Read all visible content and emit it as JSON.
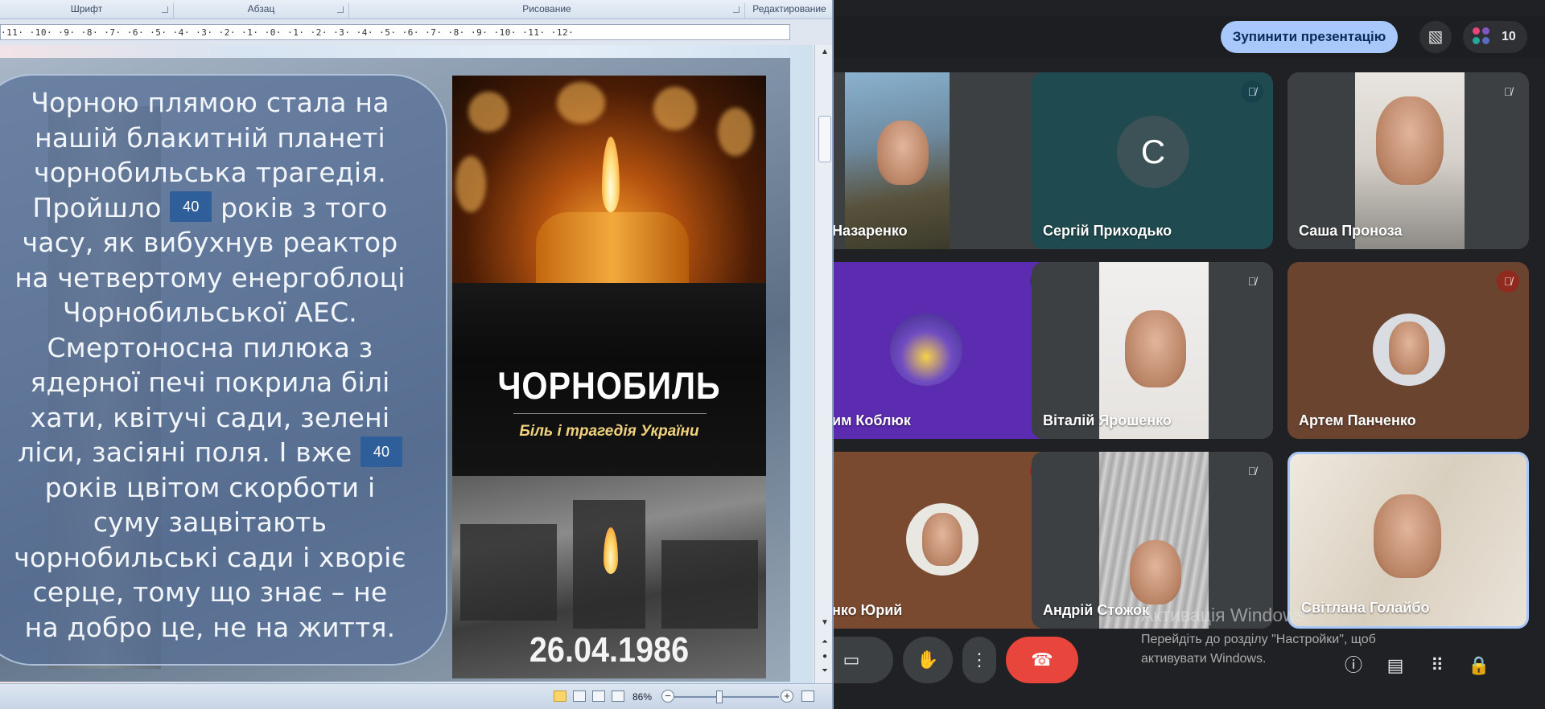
{
  "word": {
    "ribbon_groups": [
      "Шрифт",
      "Абзац",
      "Рисование",
      "Редактирование"
    ],
    "ruler": "·11·  ·10·  ·9·  ·8·  ·7·  ·6·  ·5·  ·4·  ·3·  ·2·  ·1·  ·0·  ·1·  ·2·  ·3·  ·4·  ·5·  ·6·  ·7·  ·8·  ·9·  ·10·  ·11·  ·12·",
    "slide": {
      "lines": [
        "Чорною плямою стала на",
        "нашій блакитній планеті",
        "чорнобильська трагедія.",
        "Пройшло",
        "років з того",
        "часу, як вибухнув реактор",
        "на четвертому енергоблоці",
        "Чорнобильської АЕС.",
        "Смертоносна пилюка з",
        "ядерної печі покрила білі",
        "хати, квітучі сади, зелені",
        "ліси, засіяні поля. І вже",
        "років цвітом скорботи і",
        "суму зацвітають",
        "чорнобильські сади і хворіє",
        "серце, тому що знає – не",
        "на добро це, не на життя."
      ],
      "badge1": "40",
      "badge2": "40"
    },
    "poster": {
      "title": "ЧОРНОБИЛЬ",
      "subtitle": "Біль і трагедія України",
      "date": "26.04.1986"
    },
    "zoom": "86%"
  },
  "meet": {
    "stop_presentation": "Зупинити презентацію",
    "participants_count": "10",
    "tiles": [
      {
        "name": "Назаренко"
      },
      {
        "name": "Сергій Приходько",
        "initial": "С"
      },
      {
        "name": "Саша Проноза"
      },
      {
        "name": "им Коблюк"
      },
      {
        "name": "Віталій Ярошенко"
      },
      {
        "name": "Артем Панченко"
      },
      {
        "name": "нко Юрий"
      },
      {
        "name": "Андрій Стожок"
      },
      {
        "name": "Світлана Голайбо"
      }
    ],
    "watermark_title": "Активація Windows",
    "watermark_text": "Перейдіть до розділу \"Настройки\", щоб активувати Windows.",
    "colors": {
      "accent": "#a8c7fa",
      "end_call": "#e8453c",
      "background": "#202124"
    }
  }
}
